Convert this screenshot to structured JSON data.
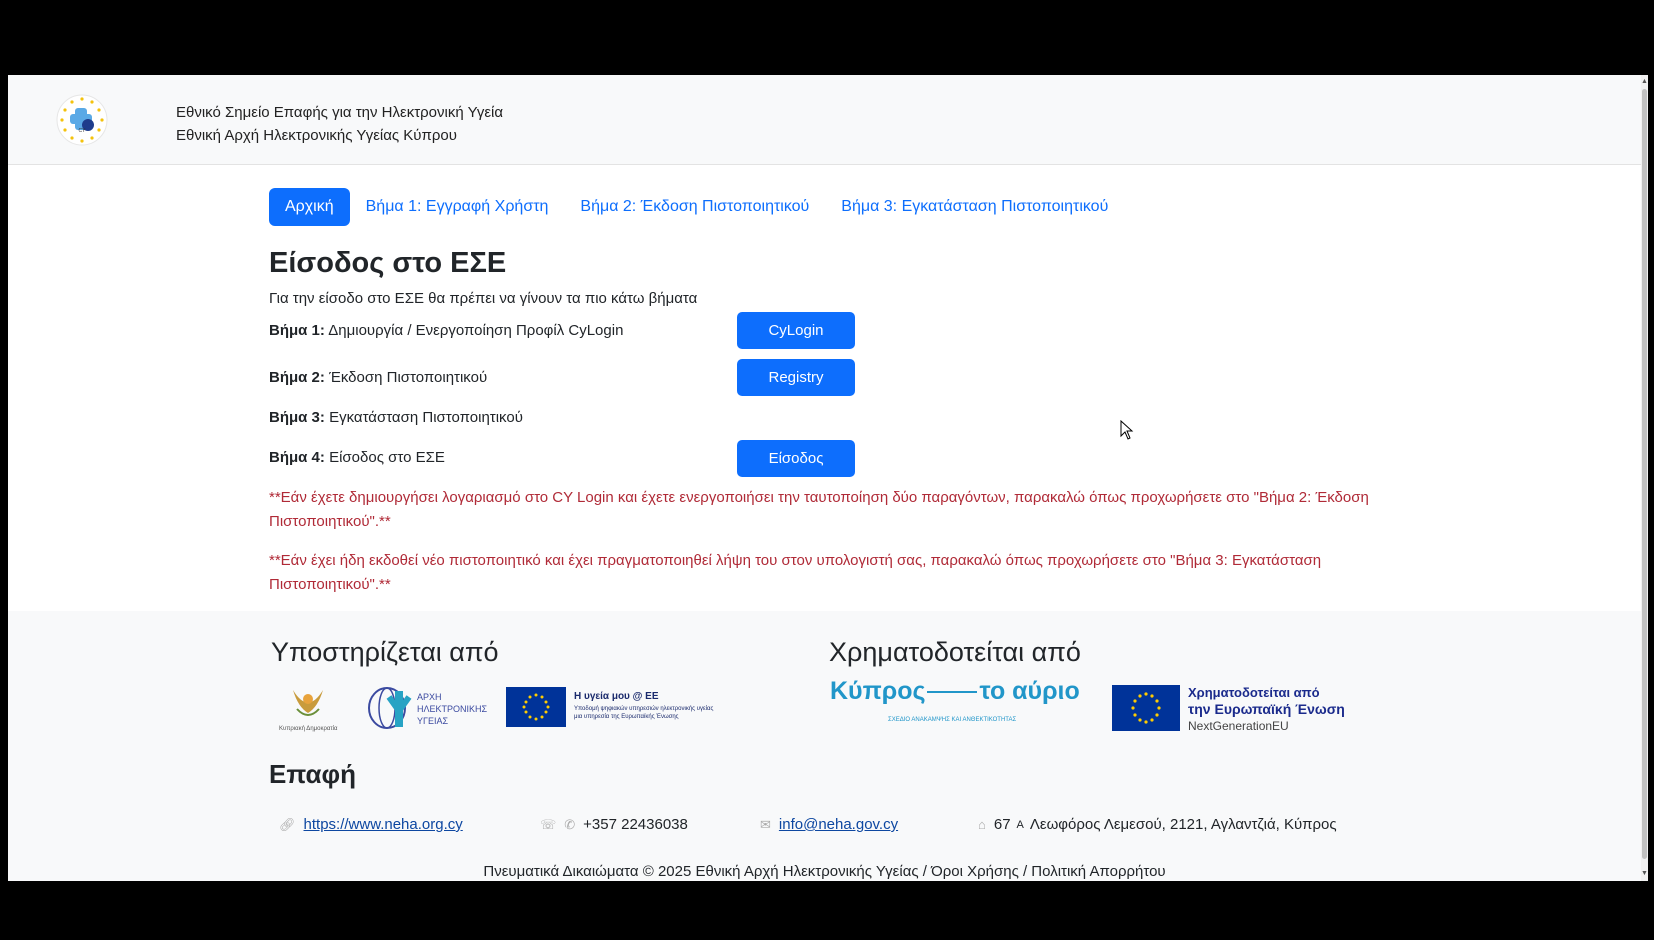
{
  "header": {
    "line1": "Εθνικό Σημείο Επαφής για την Ηλεκτρονική Υγεία",
    "line2": "Εθνική Αρχή Ηλεκτρονικής Υγείας Κύπρου"
  },
  "nav": {
    "home": "Αρχική",
    "step1": "Βήμα 1: Εγγραφή Χρήστη",
    "step2": "Βήμα 2: Έκδοση Πιστοποιητικού",
    "step3": "Βήμα 3: Εγκατάσταση Πιστοποιητικού"
  },
  "main": {
    "title": "Είσοδος στο ΕΣΕ",
    "intro": "Για την είσοδο στο ΕΣΕ θα πρέπει να γίνουν τα πιο κάτω βήματα",
    "steps": [
      {
        "label": "Βήμα 1:",
        "text": "Δημιουργία / Ενεργοποίηση Προφίλ CyLogin",
        "button": "CyLogin"
      },
      {
        "label": "Βήμα 2:",
        "text": "Έκδοση Πιστοποιητικού",
        "button": "Registry"
      },
      {
        "label": "Βήμα 3:",
        "text": "Εγκατάσταση Πιστοποιητικού"
      },
      {
        "label": "Βήμα 4:",
        "text": "Είσοδος στο ΕΣΕ",
        "button": "Είσοδος"
      }
    ],
    "note1": "**Εάν έχετε δημιουργήσει λογαριασμό στο CY Login και έχετε ενεργοποιήσει την ταυτοποίηση δύο παραγόντων, παρακαλώ όπως προχωρήσετε στο \"Βήμα 2: Έκδοση Πιστοποιητικού\".**",
    "note2": "**Εάν έχει ήδη εκδοθεί νέο πιστοποιητικό και έχει πραγματοποιηθεί λήψη του στον υπολογιστή σας, παρακαλώ όπως προχωρήσετε στο \"Βήμα 3: Εγκατάσταση Πιστοποιητικού\".**"
  },
  "footer": {
    "supported_by": "Υποστηρίζεται από",
    "funded_by": "Χρηματοδοτείται από",
    "logos": {
      "cyprus_republic": "Κυπριακή Δημοκρατία",
      "authority": [
        "ΑΡΧΗ",
        "ΗΛΕΚΤΡΟΝΙΚΗΣ",
        "ΥΓΕΙΑΣ"
      ],
      "myhealth_title": "Η υγεία μου @ ΕΕ",
      "myhealth_sub1": "Υποδομή ψηφιακών υπηρεσιών ηλεκτρονικής υγείας",
      "myhealth_sub2": "μια υπηρεσία της Ευρωπαϊκής Ένωσης",
      "kypros_a": "Κύπρος",
      "kypros_b": "το αύριο",
      "kypros_sub": "ΣΧΕΔΙΟ ΑΝΑΚΑΜΨΗΣ ΚΑΙ ΑΝΘΕΚΤΙΚΟΤΗΤΑΣ",
      "eu_funded_1": "Χρηματοδοτείται από",
      "eu_funded_2": "την Ευρωπαϊκή Ένωση",
      "eu_funded_3": "NextGenerationEU"
    },
    "contact_title": "Επαφή",
    "website": "https://www.neha.org.cy",
    "phone": "+357 22436038",
    "email": "info@neha.gov.cy",
    "address_num": "67",
    "address_sup": "A",
    "address": "Λεωφόρος Λεμεσού, 2121, Αγλαντζιά, Κύπρος",
    "copyright": "Πνευματικά Δικαιώματα © 2025 Εθνική Αρχή Ηλεκτρονικής Υγείας / Όροι Χρήσης / Πολιτική Απορρήτου"
  },
  "colors": {
    "primary": "#0d6efd",
    "note": "#b02a37",
    "eu_blue": "#003399",
    "kypros_blue": "#2196c9"
  }
}
